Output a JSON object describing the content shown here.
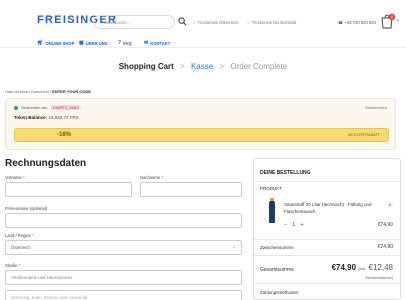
{
  "header": {
    "logo": "FREISINGER",
    "search_placeholder": "Produktsuche...",
    "trust_austria": "✓ Trockeneis Österreich",
    "trust_germany": "✓ Trockeneis Deutschland",
    "phone": "+43 720 820 820",
    "cart_count": "0"
  },
  "nav": [
    {
      "icon": "cart-icon",
      "label": "ONLINE-SHOP"
    },
    {
      "icon": "building-icon",
      "label": "ÜBER UNS"
    },
    {
      "icon": "help-icon",
      "label": "FAQ"
    },
    {
      "icon": "envelope-icon",
      "label": "KONTAKT"
    }
  ],
  "steps": {
    "step1": "Shopping Cart",
    "step2": "Kasse",
    "step3": "Order Complete",
    "separator": ">"
  },
  "coupon": {
    "prompt": "Hast du einen Gutschein?",
    "prompt_link": "ENTER YOUR CODE",
    "connected_label": "Verbunden als:",
    "code": "DIAPET_DINS",
    "remove": "Wiederrufen",
    "balance_label": "Token-Balance:",
    "balance_value": "16.846,72 FRX",
    "discount": "-18%",
    "discount_tag": "AKTIVER RABATT"
  },
  "billing": {
    "title": "Rechnungsdaten",
    "firstname_label": "Vorname",
    "lastname_label": "Nachname",
    "company_label": "Firmenname (optional)",
    "country_label": "Land / Region",
    "country_value": "Österreich",
    "street_label": "Straße",
    "street_placeholder": "Straßenname und Hausnummer",
    "street2_placeholder": "Wohnung, Suite, Zimmer usw. (optional)",
    "required_mark": "*"
  },
  "order": {
    "title": "DEINE BESTELLUNG",
    "product_header": "PRODUKT",
    "product_name": "Sauerstoff 20 Liter (technisch) - Füllung und Flaschentausch",
    "remove": "×",
    "qty_minus": "−",
    "qty_value": "1",
    "qty_plus": "+",
    "product_price": "€74,90",
    "subtotal_label": "Zwischensumme",
    "subtotal_value": "€74,90",
    "total_label": "Gesamtsumme",
    "total_value": "€74,90",
    "total_net_label": "(inkl.",
    "total_vat": "€12,48",
    "vat_label": "Mehrwertsteuer)",
    "payment_label": "Zahlungsmethoden"
  },
  "colors": {
    "brand": "#1e64c8",
    "accent_bar": "#fbd96c",
    "step_active": "#2a73d6"
  }
}
